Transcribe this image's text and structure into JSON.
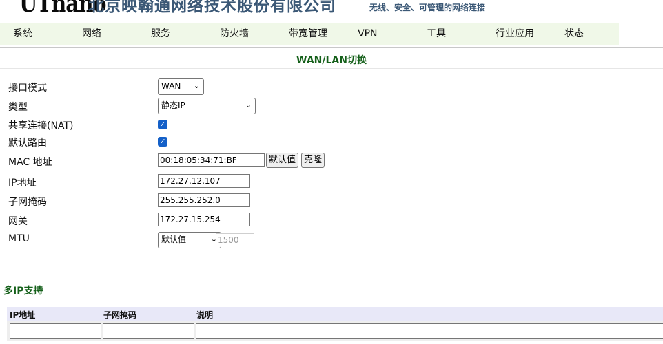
{
  "header": {
    "logo": "UTnano",
    "company": "北京映翰通网络技术股份有限公司",
    "slogan": "无线、安全、可管理的网络连接"
  },
  "menu": [
    "系统",
    "网络",
    "服务",
    "防火墙",
    "带宽管理",
    "VPN",
    "工具",
    "行业应用",
    "状态"
  ],
  "page_title": "WAN/LAN切换",
  "form": {
    "interface_mode": {
      "label": "接口模式",
      "value": "WAN"
    },
    "type": {
      "label": "类型",
      "value": "静态IP"
    },
    "nat": {
      "label": "共享连接(NAT)",
      "checked": true
    },
    "default_route": {
      "label": "默认路由",
      "checked": true
    },
    "mac": {
      "label": "MAC 地址",
      "value": "00:18:05:34:71:BF",
      "default_button": "默认值",
      "clone_button": "克隆"
    },
    "ip": {
      "label": "IP地址",
      "value": "172.27.12.107"
    },
    "netmask": {
      "label": "子网掩码",
      "value": "255.255.252.0"
    },
    "gateway": {
      "label": "网关",
      "value": "172.27.15.254"
    },
    "mtu": {
      "label": "MTU",
      "mode": "默认值",
      "value": "1500"
    }
  },
  "multi_ip": {
    "title": "多IP支持",
    "columns": [
      "IP地址",
      "子网掩码",
      "说明"
    ]
  }
}
